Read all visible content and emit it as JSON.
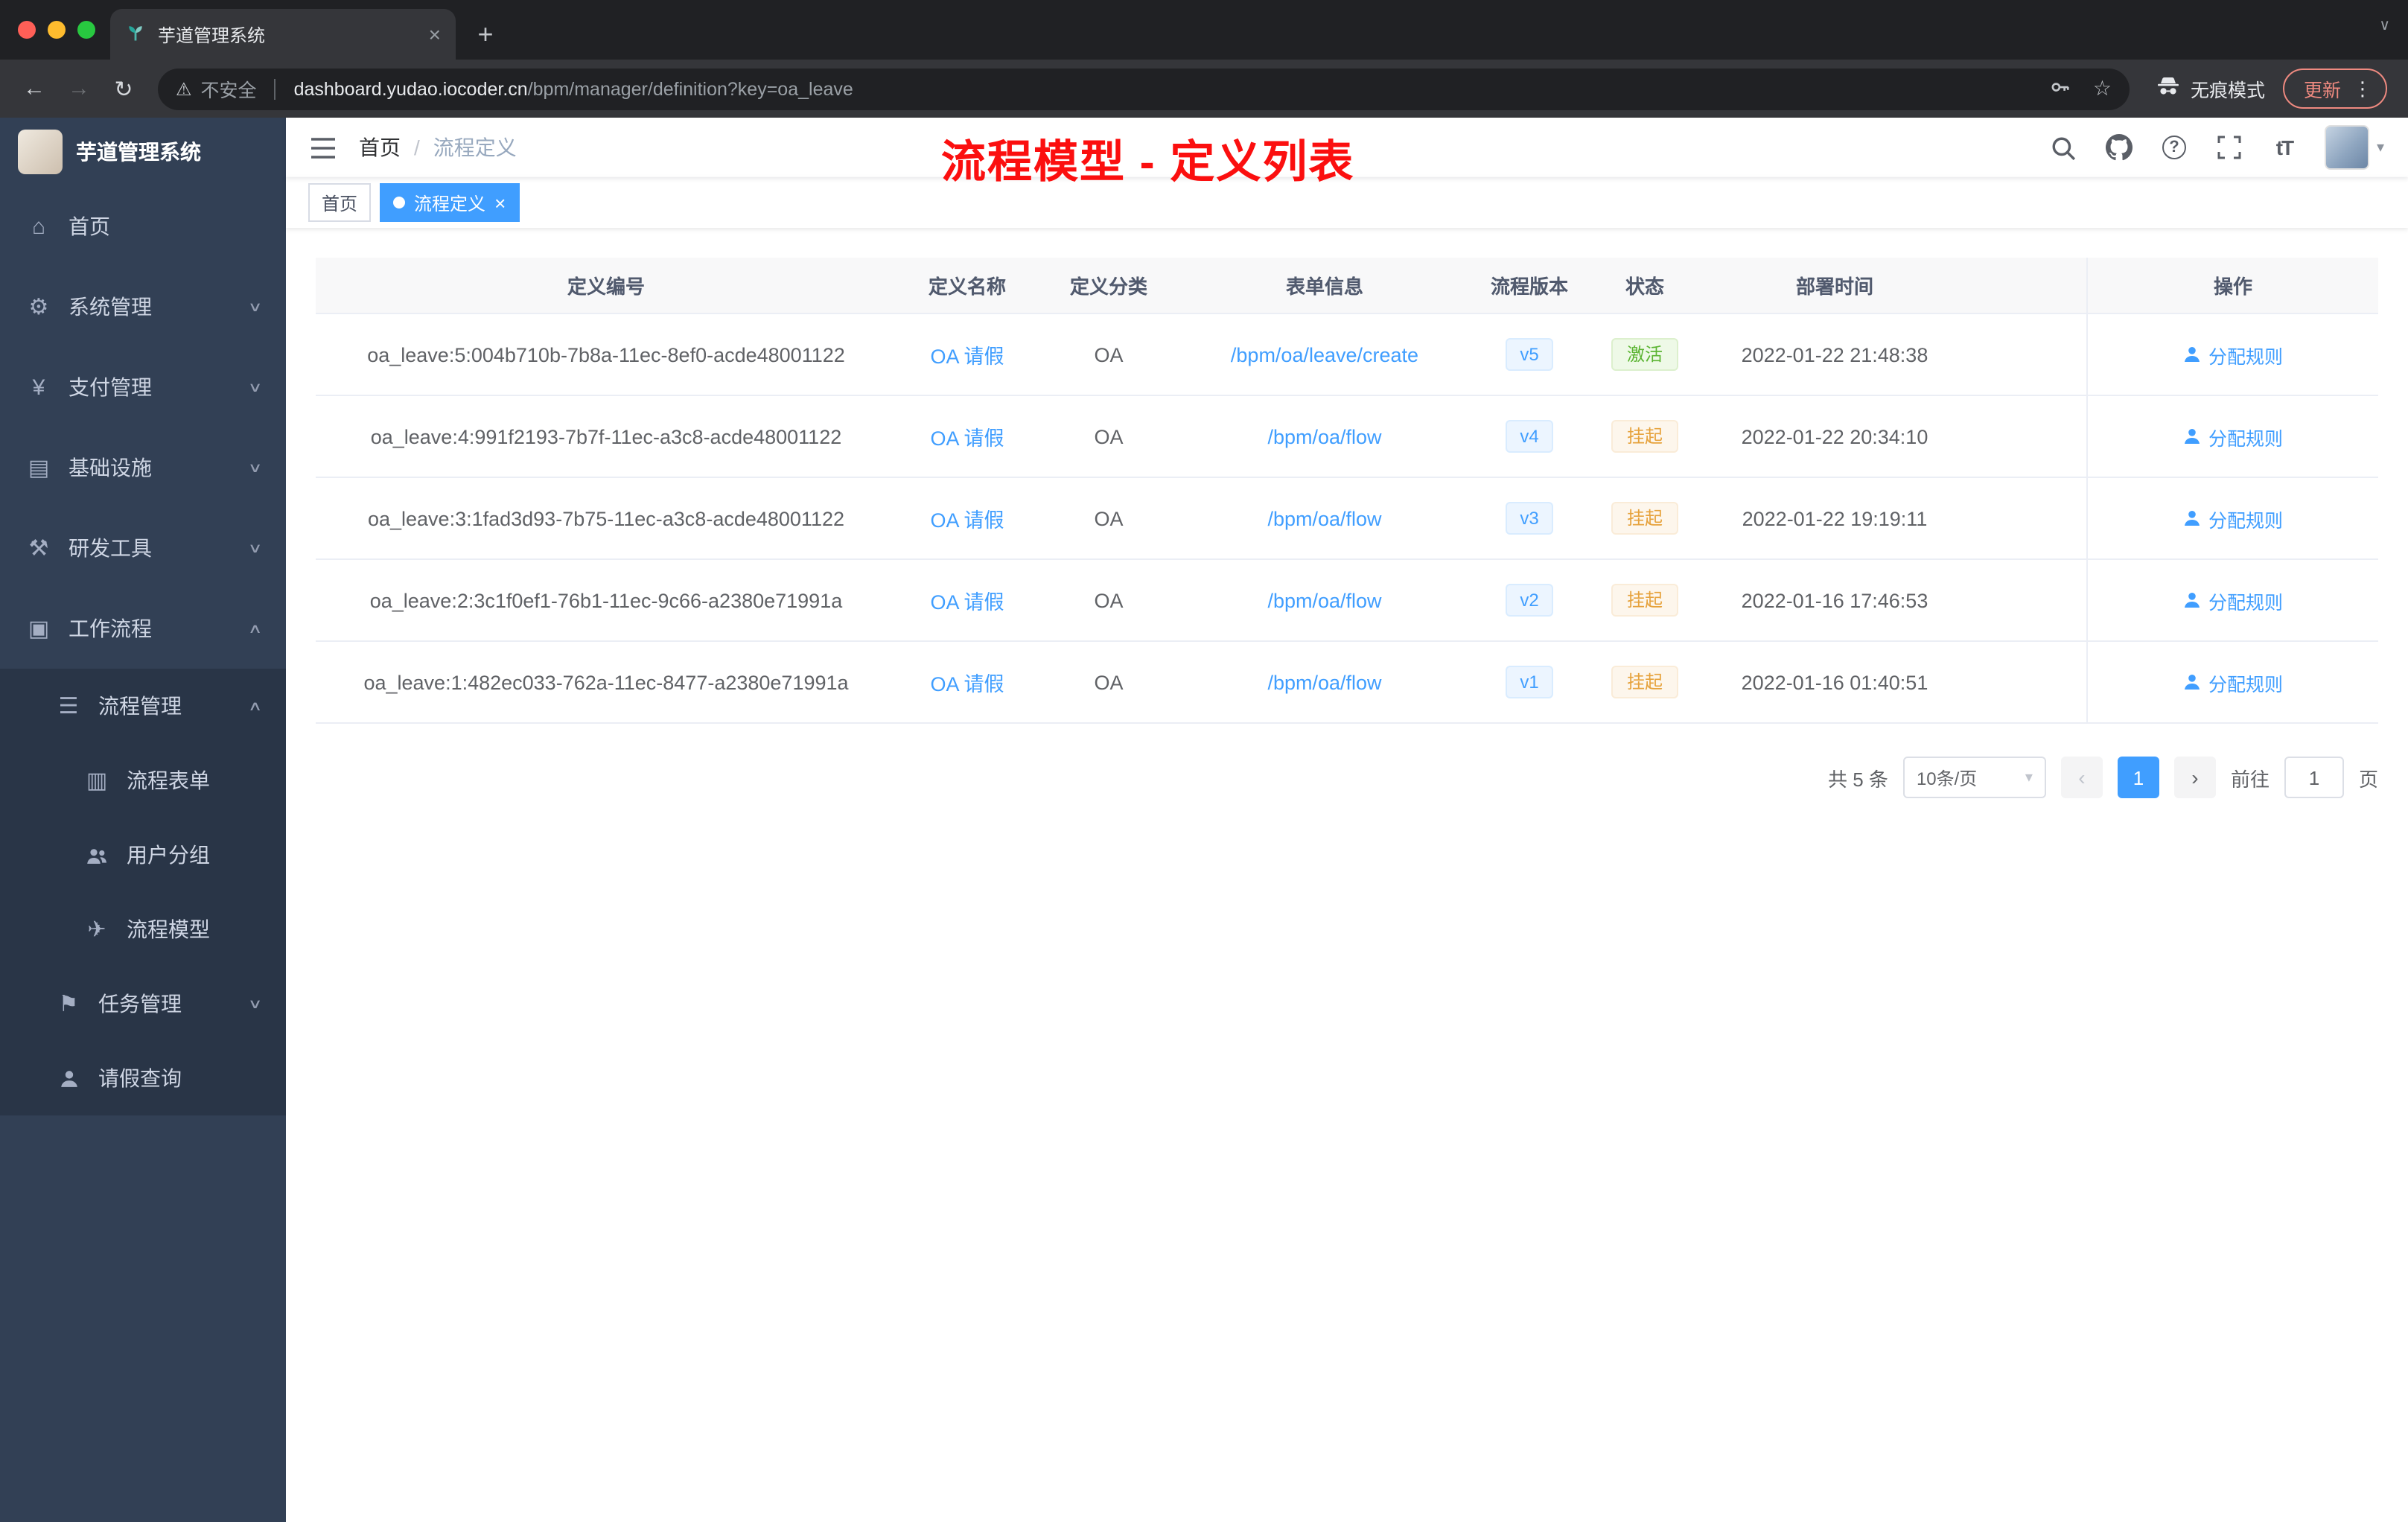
{
  "browser": {
    "tab_title": "芋道管理系统",
    "security_label": "不安全",
    "url_host": "dashboard.yudao.iocoder.cn",
    "url_path": "/bpm/manager/definition?key=oa_leave",
    "incognito_label": "无痕模式",
    "update_label": "更新"
  },
  "icons": {
    "back": "←",
    "forward": "→",
    "reload": "↻",
    "warning": "⚠",
    "star": "☆",
    "more": "⋮",
    "close": "×",
    "new_tab": "+",
    "tab_chevron": "∨",
    "caret_down": "▾",
    "chev_down": "∨",
    "chev_up": "∧",
    "home": "⌂",
    "gear": "⚙",
    "yen": "¥",
    "grid": "▤",
    "hammer": "⚒",
    "box": "▣",
    "list": "☰",
    "form": "▥",
    "plane": "✈",
    "flag": "⚑",
    "question": "?",
    "font_size": "tT",
    "prev": "‹",
    "next": "›"
  },
  "sidebar": {
    "title": "芋道管理系统",
    "items": [
      {
        "label": "首页"
      },
      {
        "label": "系统管理"
      },
      {
        "label": "支付管理"
      },
      {
        "label": "基础设施"
      },
      {
        "label": "研发工具"
      },
      {
        "label": "工作流程"
      },
      {
        "label": "流程管理"
      },
      {
        "label": "流程表单"
      },
      {
        "label": "用户分组"
      },
      {
        "label": "流程模型"
      },
      {
        "label": "任务管理"
      },
      {
        "label": "请假查询"
      }
    ]
  },
  "app_header": {
    "breadcrumb": {
      "home": "首页",
      "separator": "/",
      "current": "流程定义"
    },
    "annotation": "流程模型 - 定义列表"
  },
  "tags": {
    "home": "首页",
    "active": "流程定义"
  },
  "table": {
    "columns": [
      "定义编号",
      "定义名称",
      "定义分类",
      "表单信息",
      "流程版本",
      "状态",
      "部署时间",
      "操作"
    ],
    "rows": [
      {
        "id": "oa_leave:5:004b710b-7b8a-11ec-8ef0-acde48001122",
        "name": "OA 请假",
        "category": "OA",
        "form": "/bpm/oa/leave/create",
        "version": "v5",
        "status": "激活",
        "deploy_time": "2022-01-22 21:48:38",
        "action": "分配规则"
      },
      {
        "id": "oa_leave:4:991f2193-7b7f-11ec-a3c8-acde48001122",
        "name": "OA 请假",
        "category": "OA",
        "form": "/bpm/oa/flow",
        "version": "v4",
        "status": "挂起",
        "deploy_time": "2022-01-22 20:34:10",
        "action": "分配规则"
      },
      {
        "id": "oa_leave:3:1fad3d93-7b75-11ec-a3c8-acde48001122",
        "name": "OA 请假",
        "category": "OA",
        "form": "/bpm/oa/flow",
        "version": "v3",
        "status": "挂起",
        "deploy_time": "2022-01-22 19:19:11",
        "action": "分配规则"
      },
      {
        "id": "oa_leave:2:3c1f0ef1-76b1-11ec-9c66-a2380e71991a",
        "name": "OA 请假",
        "category": "OA",
        "form": "/bpm/oa/flow",
        "version": "v2",
        "status": "挂起",
        "deploy_time": "2022-01-16 17:46:53",
        "action": "分配规则"
      },
      {
        "id": "oa_leave:1:482ec033-762a-11ec-8477-a2380e71991a",
        "name": "OA 请假",
        "category": "OA",
        "form": "/bpm/oa/flow",
        "version": "v1",
        "status": "挂起",
        "deploy_time": "2022-01-16 01:40:51",
        "action": "分配规则"
      }
    ]
  },
  "pagination": {
    "total": "共 5 条",
    "page_size": "10条/页",
    "current_page": "1",
    "goto_label": "前往",
    "goto_value": "1",
    "unit": "页"
  },
  "colors": {
    "accent": "#409eff",
    "status_active": "#67c23a",
    "status_suspended": "#e6a23c",
    "annotation": "#fb0f0f",
    "sidebar_bg": "#324055"
  }
}
